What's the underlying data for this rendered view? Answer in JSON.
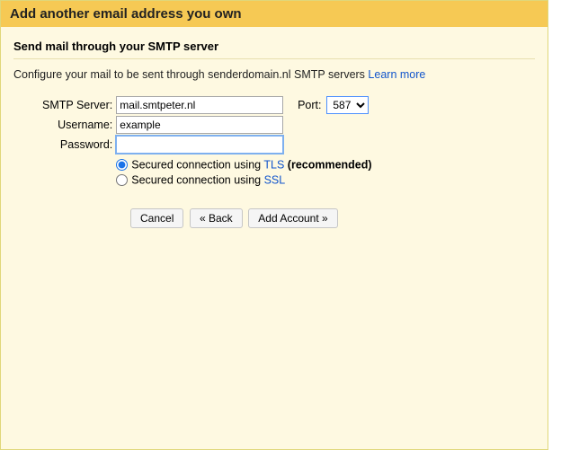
{
  "header": {
    "title": "Add another email address you own"
  },
  "sub": {
    "title": "Send mail through your SMTP server"
  },
  "desc": {
    "text": "Configure your mail to be sent through senderdomain.nl SMTP servers ",
    "learn_more": "Learn more"
  },
  "form": {
    "smtp_label": "SMTP Server:",
    "smtp_value": "mail.smtpeter.nl",
    "port_label": "Port:",
    "port_value": "587",
    "username_label": "Username:",
    "username_value": "example",
    "password_label": "Password:",
    "password_value": "",
    "tls_pre": "Secured connection using ",
    "tls_link": "TLS",
    "tls_post": " (recommended)",
    "ssl_pre": "Secured connection using ",
    "ssl_link": "SSL"
  },
  "buttons": {
    "cancel": "Cancel",
    "back": "« Back",
    "add": "Add Account »"
  }
}
